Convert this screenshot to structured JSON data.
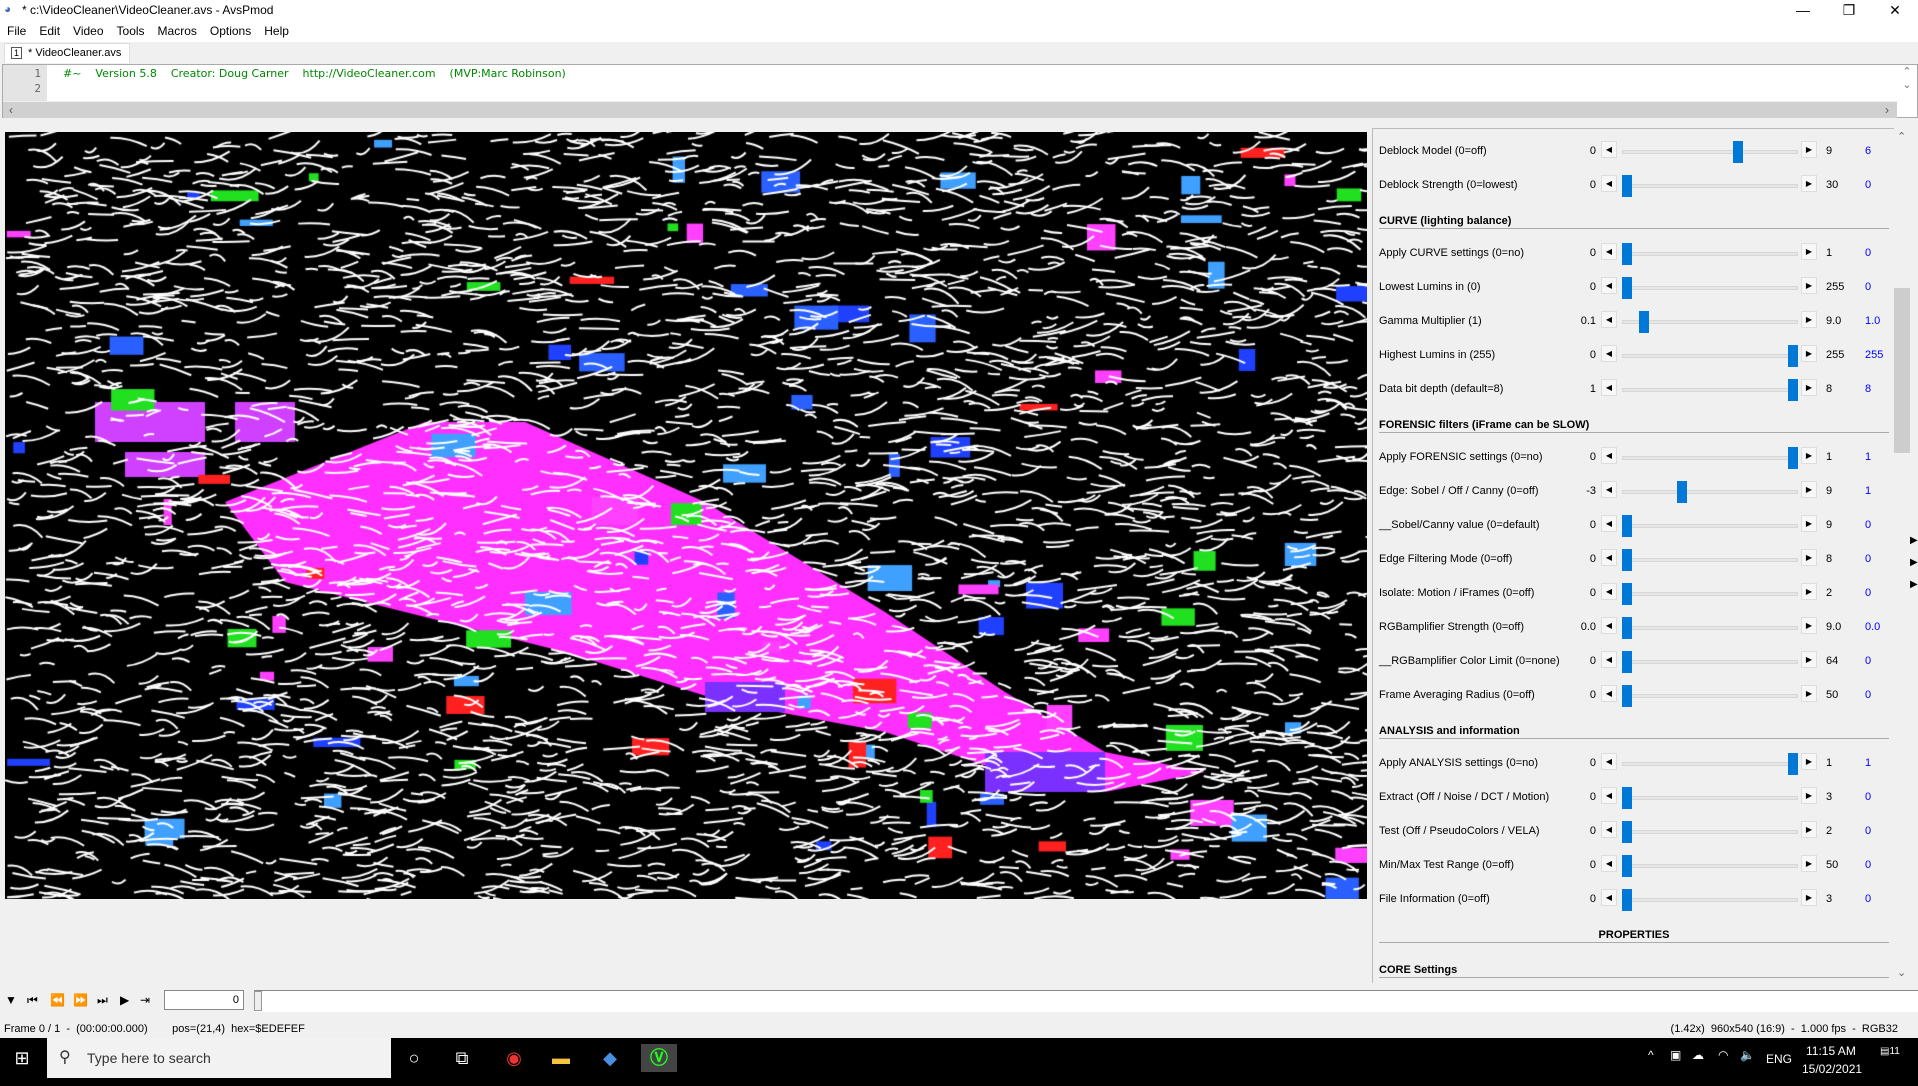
{
  "window": {
    "title": "* c:\\VideoCleaner\\VideoCleaner.avs - AvsPmod",
    "min": "—",
    "max": "❐",
    "close": "✕"
  },
  "menu": [
    "File",
    "Edit",
    "Video",
    "Tools",
    "Macros",
    "Options",
    "Help"
  ],
  "tab": {
    "label": "* VideoCleaner.avs"
  },
  "editor": {
    "line_numbers": [
      "1",
      "2"
    ],
    "line1": "#~    Version 5.8    Creator: Doug Carner    http://VideoCleaner.com    (MVP:Marc Robinson)"
  },
  "panel": {
    "rows": [
      {
        "type": "slider",
        "label": "Deblock Model (0=off)",
        "min": "0",
        "max": "9",
        "value": "6"
      },
      {
        "type": "slider",
        "label": "Deblock Strength (0=lowest)",
        "min": "0",
        "max": "30",
        "value": "0"
      },
      {
        "type": "header",
        "label": "CURVE (lighting balance)"
      },
      {
        "type": "slider",
        "label": "Apply CURVE settings (0=no)",
        "min": "0",
        "max": "1",
        "value": "0"
      },
      {
        "type": "slider",
        "label": "Lowest Lumins in (0)",
        "min": "0",
        "max": "255",
        "value": "0"
      },
      {
        "type": "slider",
        "label": "Gamma Multiplier (1)",
        "min": "0.1",
        "max": "9.0",
        "value": "1.0"
      },
      {
        "type": "slider",
        "label": "Highest Lumins in (255)",
        "min": "0",
        "max": "255",
        "value": "255"
      },
      {
        "type": "slider",
        "label": "Data bit depth (default=8)",
        "min": "1",
        "max": "8",
        "value": "8"
      },
      {
        "type": "header",
        "label": "FORENSIC filters (iFrame can be SLOW)"
      },
      {
        "type": "slider",
        "label": "Apply FORENSIC settings (0=no)",
        "min": "0",
        "max": "1",
        "value": "1"
      },
      {
        "type": "slider",
        "label": "Edge: Sobel / Off / Canny (0=off)",
        "min": "-3",
        "max": "9",
        "value": "1"
      },
      {
        "type": "slider",
        "label": "__Sobel/Canny value (0=default)",
        "min": "0",
        "max": "9",
        "value": "0"
      },
      {
        "type": "slider",
        "label": "Edge Filtering Mode (0=off)",
        "min": "0",
        "max": "8",
        "value": "0"
      },
      {
        "type": "slider",
        "label": "Isolate: Motion / iFrames (0=off)",
        "min": "0",
        "max": "2",
        "value": "0"
      },
      {
        "type": "slider",
        "label": "RGBamplifier Strength (0=off)",
        "min": "0.0",
        "max": "9.0",
        "value": "0.0"
      },
      {
        "type": "slider",
        "label": "__RGBamplifier Color Limit (0=none)",
        "min": "0",
        "max": "64",
        "value": "0"
      },
      {
        "type": "slider",
        "label": "Frame Averaging Radius (0=off)",
        "min": "0",
        "max": "50",
        "value": "0"
      },
      {
        "type": "header",
        "label": "ANALYSIS and information"
      },
      {
        "type": "slider",
        "label": "Apply ANALYSIS settings (0=no)",
        "min": "0",
        "max": "1",
        "value": "1"
      },
      {
        "type": "slider",
        "label": "Extract (Off / Noise / DCT / Motion)",
        "min": "0",
        "max": "3",
        "value": "0"
      },
      {
        "type": "slider",
        "label": "Test (Off / PseudoColors / VELA)",
        "min": "0",
        "max": "2",
        "value": "0"
      },
      {
        "type": "slider",
        "label": "Min/Max Test Range (0=off)",
        "min": "0",
        "max": "50",
        "value": "0"
      },
      {
        "type": "slider",
        "label": "File Information (0=off)",
        "min": "0",
        "max": "3",
        "value": "0"
      },
      {
        "type": "header",
        "label": "PROPERTIES",
        "center": true
      },
      {
        "type": "header",
        "label": "CORE Settings"
      }
    ]
  },
  "transport": {
    "frame_value": "0"
  },
  "status": {
    "left": "Frame 0 / 1  -  (00:00:00.000)        pos=(21,4)  hex=$EDEFEF",
    "right": "(1.42x)  960x540 (16:9)  -  1.000 fps  -  RGB32"
  },
  "taskbar": {
    "search_placeholder": "Type here to search",
    "language": "ENG",
    "time": "11:15 AM",
    "date": "15/02/2021",
    "notifications": "11"
  },
  "colors": {
    "accent": "#0078d7",
    "value": "#0000ff",
    "code": "#008800",
    "magenta": "#ff30ff"
  }
}
